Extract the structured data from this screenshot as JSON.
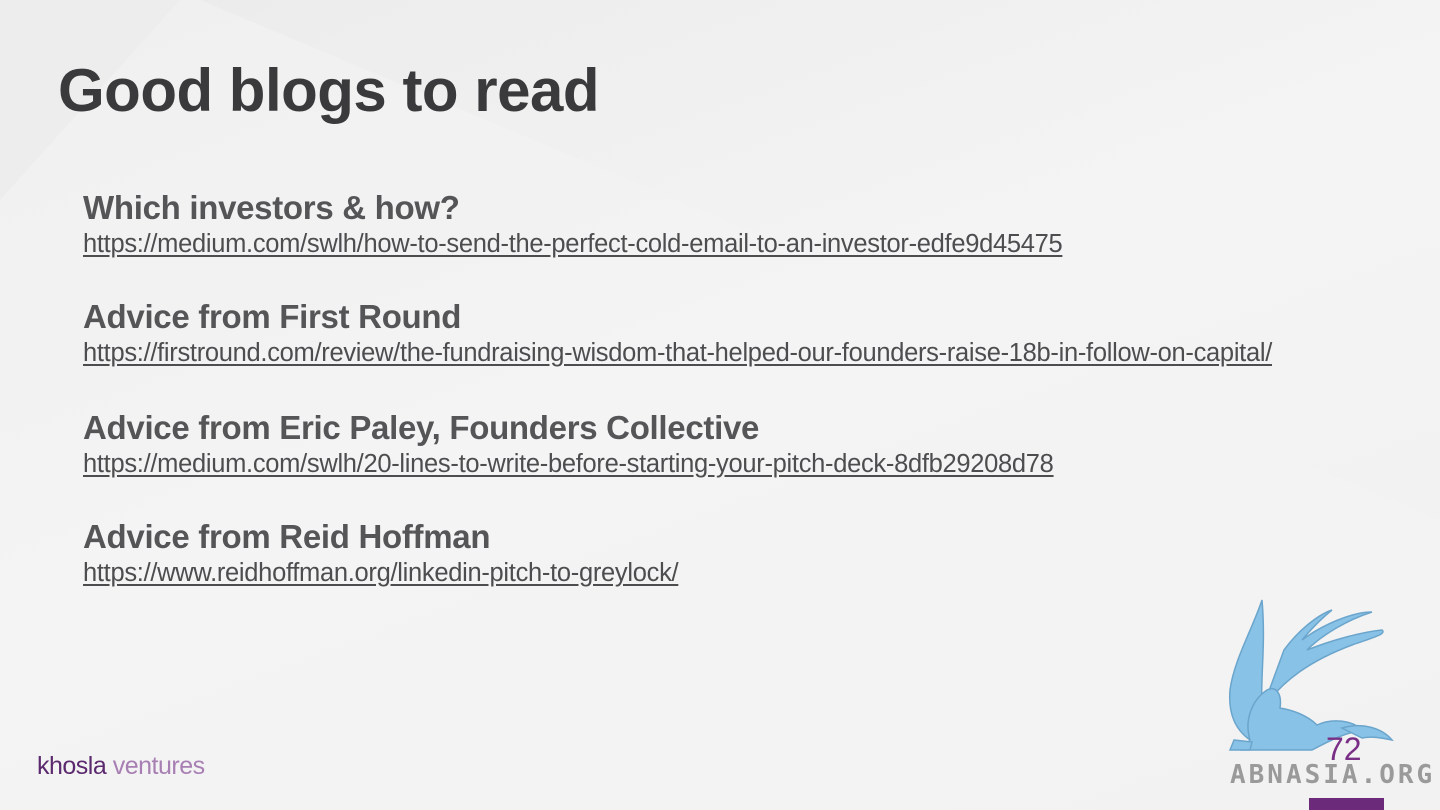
{
  "slide": {
    "title": "Good blogs to read",
    "page_number": "72"
  },
  "blogs": [
    {
      "heading": "Which investors & how?",
      "url": "https://medium.com/swlh/how-to-send-the-perfect-cold-email-to-an-investor-edfe9d45475"
    },
    {
      "heading": "Advice from First Round",
      "url": "https://firstround.com/review/the-fundraising-wisdom-that-helped-our-founders-raise-18b-in-follow-on-capital/"
    },
    {
      "heading": "Advice from Eric Paley, Founders Collective",
      "url": "https://medium.com/swlh/20-lines-to-write-before-starting-your-pitch-deck-8dfb29208d78"
    },
    {
      "heading": "Advice from Reid Hoffman",
      "url": "https://www.reidhoffman.org/linkedin-pitch-to-greylock/"
    }
  ],
  "footer": {
    "brand_first": "khosla",
    "brand_second": "ventures"
  },
  "watermark": {
    "text": "ABNASIA.ORG",
    "icon": "griffin-icon"
  },
  "colors": {
    "title": "#3a3a3c",
    "brand_purple": "#6b2b7a",
    "watermark_blue": "#6fb4e0"
  }
}
